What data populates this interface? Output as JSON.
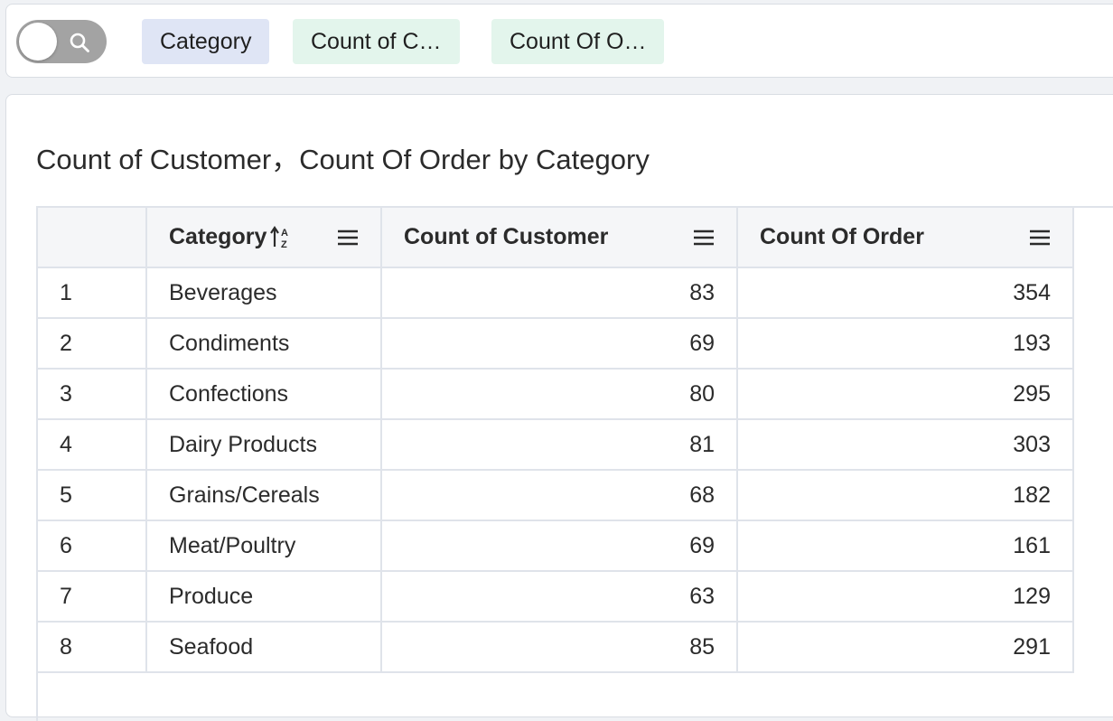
{
  "toolbar": {
    "toggle_icon": "search-icon",
    "chips": [
      {
        "label": "Category",
        "kind": "dimension"
      },
      {
        "label": "Count of C…",
        "kind": "measure"
      },
      {
        "label": "Count Of O…",
        "kind": "measure"
      }
    ]
  },
  "chart": {
    "title": "Count of Customer，Count Of Order by Category"
  },
  "table": {
    "columns": [
      {
        "label": "",
        "key": "index"
      },
      {
        "label": "Category",
        "key": "category",
        "sorted": "ascending",
        "sort_icon": "sort-a-z-icon",
        "menu_icon": "menu-icon"
      },
      {
        "label": "Count of Customer",
        "key": "count_of_customer",
        "menu_icon": "menu-icon"
      },
      {
        "label": "Count Of Order",
        "key": "count_of_order",
        "menu_icon": "menu-icon"
      }
    ],
    "rows": [
      {
        "index": "1",
        "category": "Beverages",
        "count_of_customer": "83",
        "count_of_order": "354"
      },
      {
        "index": "2",
        "category": "Condiments",
        "count_of_customer": "69",
        "count_of_order": "193"
      },
      {
        "index": "3",
        "category": "Confections",
        "count_of_customer": "80",
        "count_of_order": "295"
      },
      {
        "index": "4",
        "category": "Dairy Products",
        "count_of_customer": "81",
        "count_of_order": "303"
      },
      {
        "index": "5",
        "category": "Grains/Cereals",
        "count_of_customer": "68",
        "count_of_order": "182"
      },
      {
        "index": "6",
        "category": "Meat/Poultry",
        "count_of_customer": "69",
        "count_of_order": "161"
      },
      {
        "index": "7",
        "category": "Produce",
        "count_of_customer": "63",
        "count_of_order": "129"
      },
      {
        "index": "8",
        "category": "Seafood",
        "count_of_customer": "85",
        "count_of_order": "291"
      }
    ]
  },
  "chart_data": {
    "type": "table",
    "title": "Count of Customer，Count Of Order by Category",
    "columns": [
      "Category",
      "Count of Customer",
      "Count Of Order"
    ],
    "categories": [
      "Beverages",
      "Condiments",
      "Confections",
      "Dairy Products",
      "Grains/Cereals",
      "Meat/Poultry",
      "Produce",
      "Seafood"
    ],
    "series": [
      {
        "name": "Count of Customer",
        "values": [
          83,
          69,
          80,
          81,
          68,
          69,
          63,
          85
        ]
      },
      {
        "name": "Count Of Order",
        "values": [
          354,
          193,
          295,
          303,
          182,
          161,
          129,
          291
        ]
      }
    ]
  },
  "colors": {
    "dimension_chip": "#dfe5f5",
    "measure_chip": "#e3f5ec",
    "toggle_track": "#a3a3a3",
    "header_bg": "#f5f6f8",
    "grid_line": "#dfe3ea"
  }
}
